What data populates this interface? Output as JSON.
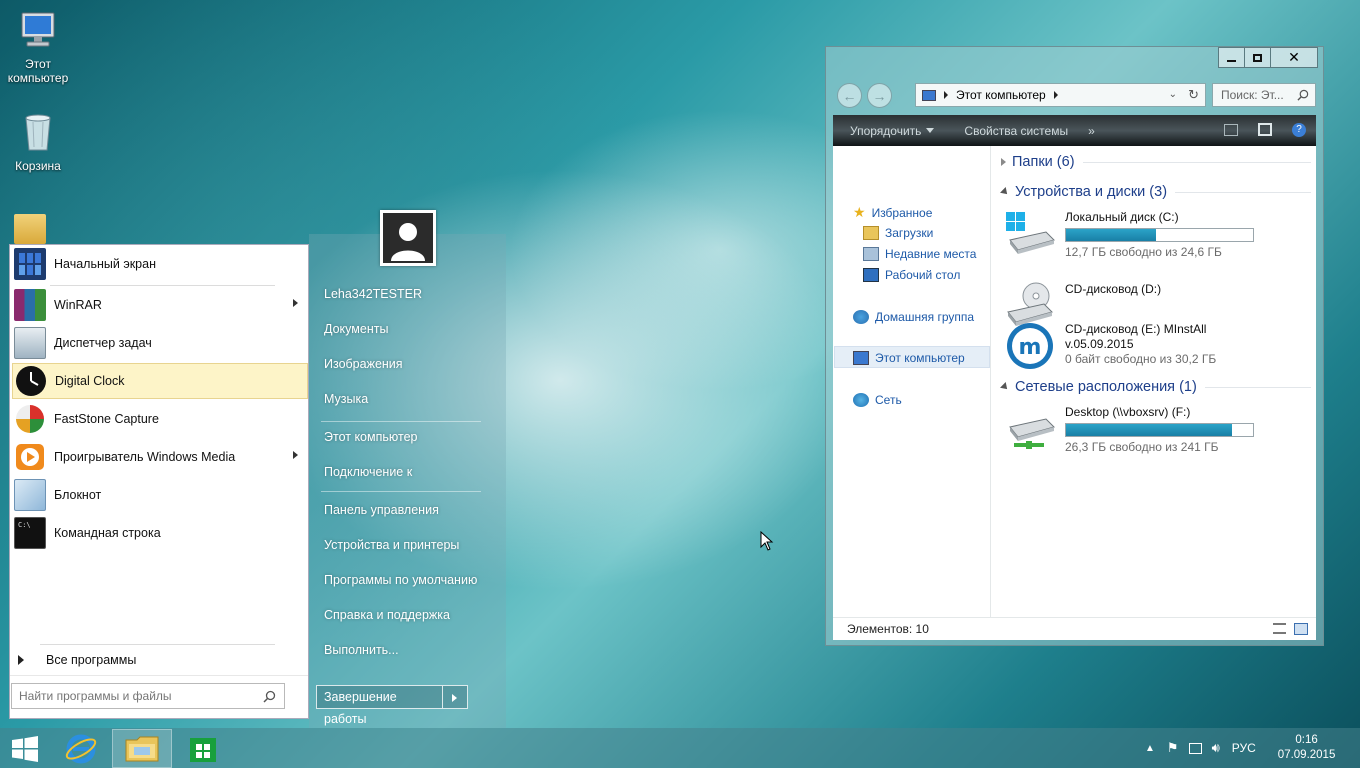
{
  "desktop": {
    "icons": [
      {
        "label": "Этот компьютер"
      },
      {
        "label": "Корзина"
      }
    ]
  },
  "start_menu": {
    "programs": [
      {
        "label": "Начальный экран",
        "has_submenu": false
      },
      {
        "label": "WinRAR",
        "has_submenu": true
      },
      {
        "label": "Диспетчер задач",
        "has_submenu": false
      },
      {
        "label": "Digital Clock",
        "has_submenu": false,
        "highlighted": true
      },
      {
        "label": "FastStone Capture",
        "has_submenu": false
      },
      {
        "label": "Проигрыватель Windows Media",
        "has_submenu": true
      },
      {
        "label": "Блокнот",
        "has_submenu": false
      },
      {
        "label": "Командная строка",
        "has_submenu": false
      }
    ],
    "all_programs": "Все программы",
    "search_placeholder": "Найти программы и файлы",
    "right_links": [
      "Leha342TESTER",
      "Документы",
      "Изображения",
      "Музыка",
      "Этот компьютер",
      "Подключение к",
      "Панель управления",
      "Устройства и принтеры",
      "Программы по умолчанию",
      "Справка и поддержка",
      "Выполнить..."
    ],
    "shutdown_label": "Завершение работы"
  },
  "explorer": {
    "address": "Этот компьютер",
    "search_placeholder": "Поиск: Эт...",
    "toolbar": {
      "organize": "Упорядочить",
      "system_properties": "Свойства системы",
      "more": "»"
    },
    "nav": {
      "favorites": "Избранное",
      "downloads": "Загрузки",
      "recent": "Недавние места",
      "desktop": "Рабочий стол",
      "homegroup": "Домашняя группа",
      "this_pc": "Этот компьютер",
      "network": "Сеть"
    },
    "groups": {
      "folders": "Папки (6)",
      "devices": "Устройства и диски (3)",
      "network_locations": "Сетевые расположения (1)"
    },
    "drives": [
      {
        "name": "Локальный диск (C:)",
        "free": "12,7 ГБ свободно из 24,6 ГБ",
        "used_fraction": 0.48
      },
      {
        "name": "CD-дисковод (D:)"
      },
      {
        "name_line1": "CD-дисковод (E:) MInstAll",
        "name_line2": "v.05.09.2015",
        "free": "0 байт свободно из 30,2 ГБ"
      },
      {
        "name": "Desktop (\\\\vboxsrv) (F:)",
        "free": "26,3 ГБ свободно из 241 ГБ",
        "used_fraction": 0.89
      }
    ],
    "status": "Элементов: 10",
    "colors": {
      "bar_fill": "#1f8fb6",
      "link": "#1e5aa8",
      "group": "#1e3f8a"
    }
  },
  "taskbar": {
    "language": "РУС",
    "time": "0:16",
    "date": "07.09.2015"
  }
}
